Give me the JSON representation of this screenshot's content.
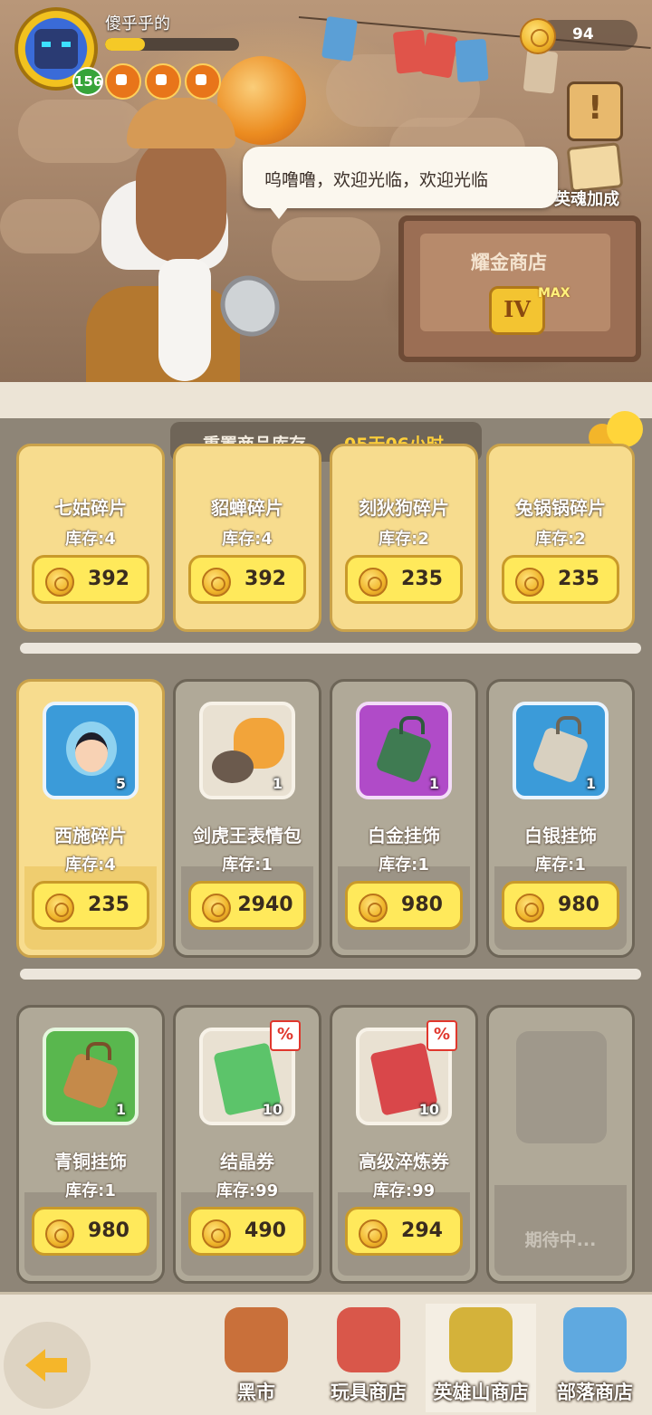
{
  "player": {
    "name": "傻乎乎的",
    "level": "156",
    "xp_fraction": 0.3
  },
  "currency": {
    "coins": "94"
  },
  "npc": {
    "speech": "呜噜噜，欢迎光临，欢迎光临"
  },
  "side": {
    "hero_bonus": "英魂加成"
  },
  "shop": {
    "name": "耀金商店",
    "tier": "IV",
    "tier_badge": "MAX"
  },
  "reset": {
    "label": "重置商品库存",
    "time": "05天06小时"
  },
  "chat": {
    "label": "聊天"
  },
  "rows": [
    {
      "items": [
        {
          "name": "七姑碎片",
          "stock": "库存:4",
          "price": "392"
        },
        {
          "name": "貂蝉碎片",
          "stock": "库存:4",
          "price": "392"
        },
        {
          "name": "刻狄狗碎片",
          "stock": "库存:2",
          "price": "235"
        },
        {
          "name": "兔锅锅碎片",
          "stock": "库存:2",
          "price": "235"
        }
      ]
    },
    {
      "items": [
        {
          "name": "西施碎片",
          "stock": "库存:4",
          "price": "235",
          "qty": "5",
          "icon": "xishi-fragment-icon",
          "frame": "#3b9bd9"
        },
        {
          "name": "剑虎王表情包",
          "stock": "库存:1",
          "price": "2940",
          "qty": "1",
          "icon": "tiger-emoji-pack-icon",
          "frame": "#e9e1d2"
        },
        {
          "name": "白金挂饰",
          "stock": "库存:1",
          "price": "980",
          "qty": "1",
          "icon": "platinum-pendant-icon",
          "frame": "#b04bc8"
        },
        {
          "name": "白银挂饰",
          "stock": "库存:1",
          "price": "980",
          "qty": "1",
          "icon": "silver-pendant-icon",
          "frame": "#3b9bd9"
        }
      ]
    },
    {
      "items": [
        {
          "name": "青铜挂饰",
          "stock": "库存:1",
          "price": "980",
          "qty": "1",
          "icon": "bronze-pendant-icon",
          "frame": "#59b74e"
        },
        {
          "name": "结晶券",
          "stock": "库存:99",
          "price": "490",
          "qty": "10",
          "icon": "crystal-voucher-icon",
          "frame": "#e9e1d2",
          "sale": "%"
        },
        {
          "name": "高级淬炼券",
          "stock": "库存:99",
          "price": "294",
          "qty": "10",
          "icon": "refine-voucher-icon",
          "frame": "#e9e1d2",
          "sale": "%"
        },
        {
          "pending": "期待中..."
        }
      ]
    }
  ],
  "nav": {
    "tabs": [
      {
        "label": "黑市"
      },
      {
        "label": "玩具商店"
      },
      {
        "label": "英雄山商店"
      },
      {
        "label": "部落商店"
      }
    ]
  },
  "colors": {
    "gold_card": "#f7dc8e",
    "grey_card": "#b0a998",
    "price_button": "#ffe95b",
    "reset_time": "#ffd039"
  }
}
